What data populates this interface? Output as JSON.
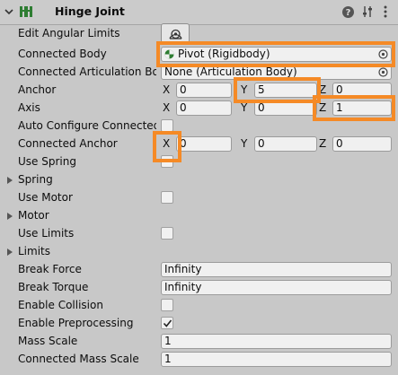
{
  "header": {
    "title": "Hinge Joint",
    "icons": [
      "chevron-down-icon",
      "hinge-joint-icon",
      "help-icon",
      "presets-icon",
      "kebab-menu-icon"
    ]
  },
  "rows": {
    "edit_angular_limits": {
      "label": "Edit Angular Limits",
      "icon": "edit-angular-limits-icon"
    },
    "connected_body": {
      "label": "Connected Body",
      "value": "Pivot (Rigidbody)",
      "icon": "rigidbody-icon"
    },
    "connected_articulation_body": {
      "label": "Connected Articulation Body",
      "value": "None (Articulation Body)"
    },
    "anchor": {
      "label": "Anchor",
      "x_label": "X",
      "x": "0",
      "y_label": "Y",
      "y": "5",
      "z_label": "Z",
      "z": "0"
    },
    "axis": {
      "label": "Axis",
      "x_label": "X",
      "x": "0",
      "y_label": "Y",
      "y": "0",
      "z_label": "Z",
      "z": "1"
    },
    "auto_configure": {
      "label": "Auto Configure Connected Anchor",
      "checked": false
    },
    "connected_anchor": {
      "label": "Connected Anchor",
      "x_label": "X",
      "x": "0",
      "y_label": "Y",
      "y": "0",
      "z_label": "Z",
      "z": "0"
    },
    "use_spring": {
      "label": "Use Spring",
      "checked": false
    },
    "spring": {
      "label": "Spring"
    },
    "use_motor": {
      "label": "Use Motor",
      "checked": false
    },
    "motor": {
      "label": "Motor"
    },
    "use_limits": {
      "label": "Use Limits",
      "checked": false
    },
    "limits": {
      "label": "Limits"
    },
    "break_force": {
      "label": "Break Force",
      "value": "Infinity"
    },
    "break_torque": {
      "label": "Break Torque",
      "value": "Infinity"
    },
    "enable_collision": {
      "label": "Enable Collision",
      "checked": false
    },
    "enable_preprocessing": {
      "label": "Enable Preprocessing",
      "checked": true
    },
    "mass_scale": {
      "label": "Mass Scale",
      "value": "1"
    },
    "connected_mass_scale": {
      "label": "Connected Mass Scale",
      "value": "1"
    }
  },
  "colors": {
    "highlight": "#f58a26",
    "panel": "#c8c8c8",
    "field": "#f0f0f0",
    "accent_green": "#2e7d32"
  }
}
